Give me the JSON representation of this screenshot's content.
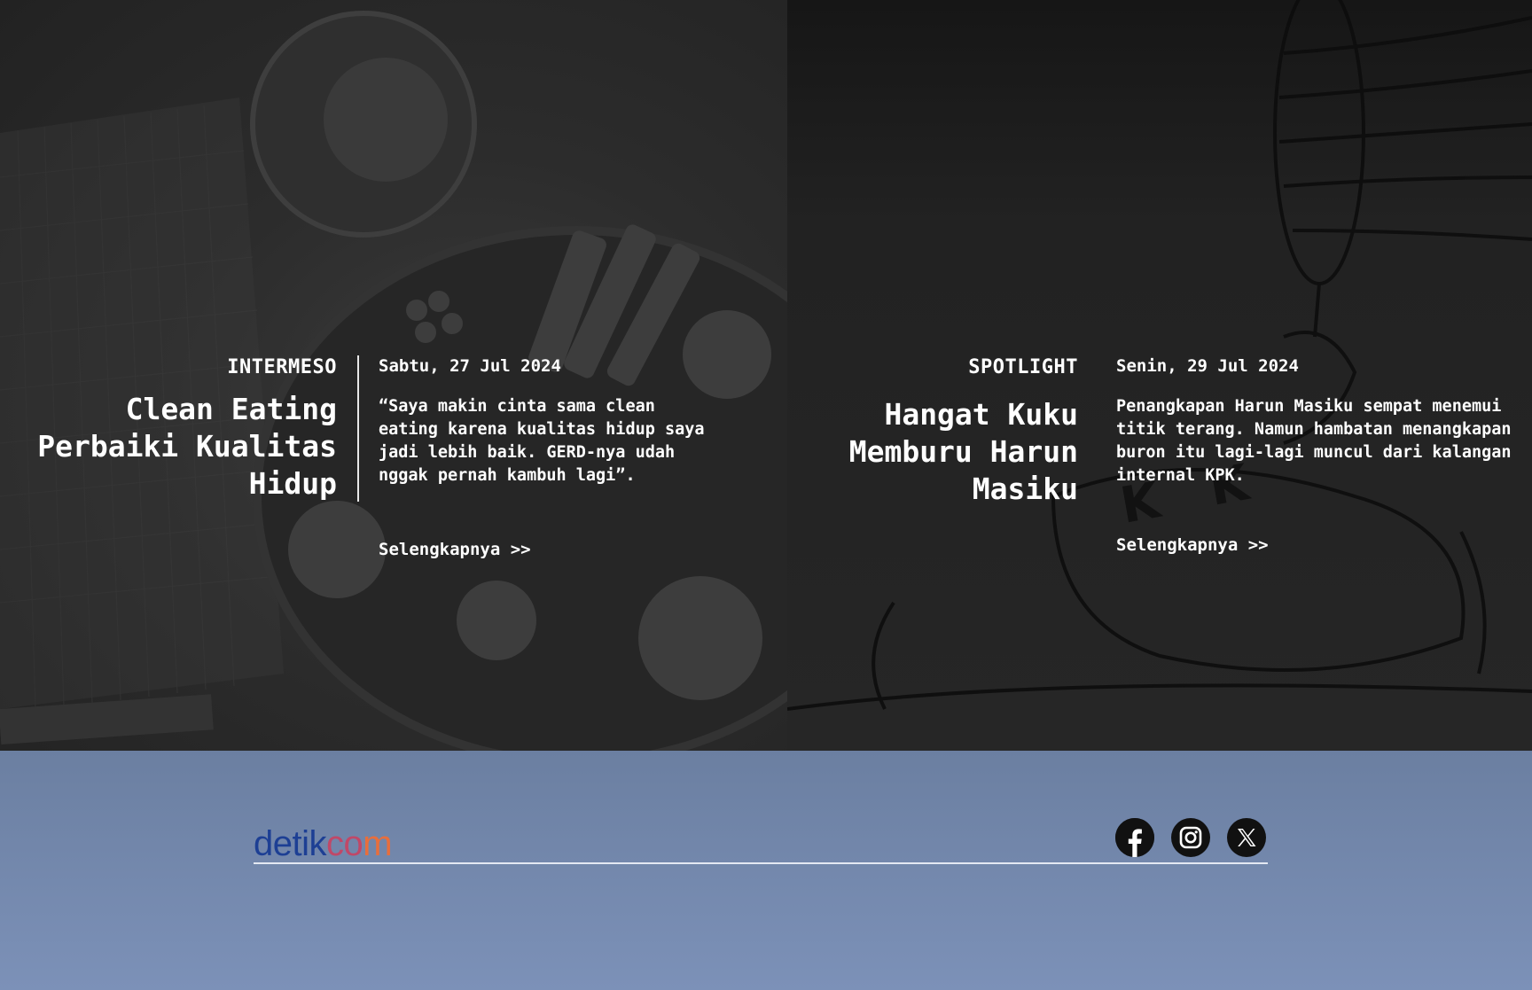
{
  "features": [
    {
      "category": "INTERMESO",
      "title": "Clean Eating Perbaiki Kualitas Hidup",
      "date": "Sabtu, 27 Jul 2024",
      "excerpt": "“Saya makin cinta sama clean eating karena kualitas hidup saya jadi lebih baik. GERD-nya udah nggak pernah kambuh lagi”.",
      "more": "Selengkapnya >>"
    },
    {
      "category": "SPOTLIGHT",
      "title": "Hangat Kuku Memburu Harun Masiku",
      "date": "Senin, 29 Jul 2024",
      "excerpt": "Penangkapan Harun Masiku sempat menemui titik terang. Namun hambatan menangkapan buron itu lagi-lagi muncul dari kalangan internal KPK.",
      "more": "Selengkapnya >>"
    }
  ],
  "footer": {
    "logo_part1": "detik",
    "logo_part2": "co",
    "logo_part3": "m",
    "socials": [
      "facebook-icon",
      "instagram-icon",
      "x-icon"
    ]
  },
  "colors": {
    "footer_bg": "#7189b0",
    "logo_blue": "#1d3f94",
    "logo_pink": "#c04868",
    "logo_orange": "#e86e3c"
  }
}
